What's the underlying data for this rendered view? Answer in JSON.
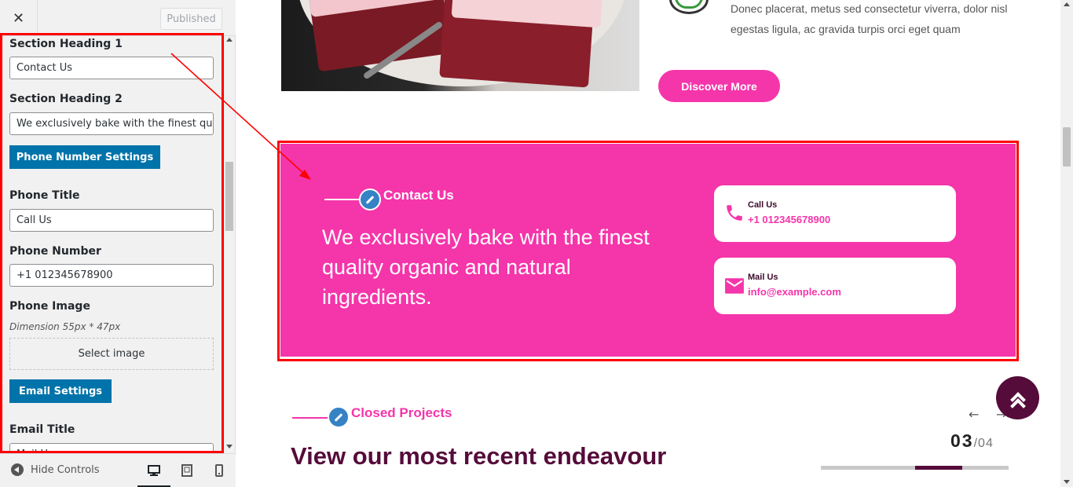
{
  "customizer": {
    "close_label": "✕",
    "published_label": "Published",
    "fields": {
      "section_heading_1_label": "Section Heading 1",
      "section_heading_1_value": "Contact Us",
      "section_heading_2_label": "Section Heading 2",
      "section_heading_2_value": "We exclusively bake with the finest quality organic and natural ingredients.",
      "phone_settings_button": "Phone Number Settings",
      "phone_title_label": "Phone Title",
      "phone_title_value": "Call Us",
      "phone_number_label": "Phone Number",
      "phone_number_value": "+1 012345678900",
      "phone_image_label": "Phone Image",
      "phone_image_desc": "Dimension 55px * 47px",
      "select_image_button": "Select image",
      "email_settings_button": "Email Settings",
      "email_title_label": "Email Title",
      "email_title_value": "Mail Us"
    },
    "footer": {
      "hide_controls_label": "Hide Controls",
      "devices": [
        "desktop-icon",
        "tablet-icon",
        "mobile-icon"
      ]
    }
  },
  "preview": {
    "body_text": "Donec placerat, metus sed consectetur viverra, dolor nisl egestas ligula, ac gravida turpis orci eget quam",
    "discover_button": "Discover More",
    "contact": {
      "label": "Contact Us",
      "heading": "We exclusively bake with the finest quality organic and natural ingredients.",
      "cards": [
        {
          "title": "Call Us",
          "value": "+1 012345678900",
          "icon": "phone-icon"
        },
        {
          "title": "Mail Us",
          "value": "info@example.com",
          "icon": "mail-icon"
        }
      ]
    },
    "projects": {
      "label": "Closed Projects",
      "heading": "View our most recent endeavour",
      "counter_current": "03",
      "counter_total": "/04",
      "progress_fraction": 0.25,
      "prev_arrow": "←",
      "next_arrow": "→"
    }
  },
  "colors": {
    "accent_pink": "#f535aa",
    "dark_plum": "#550c3a",
    "wp_blue": "#0073aa",
    "annotation_red": "#ff0000"
  }
}
